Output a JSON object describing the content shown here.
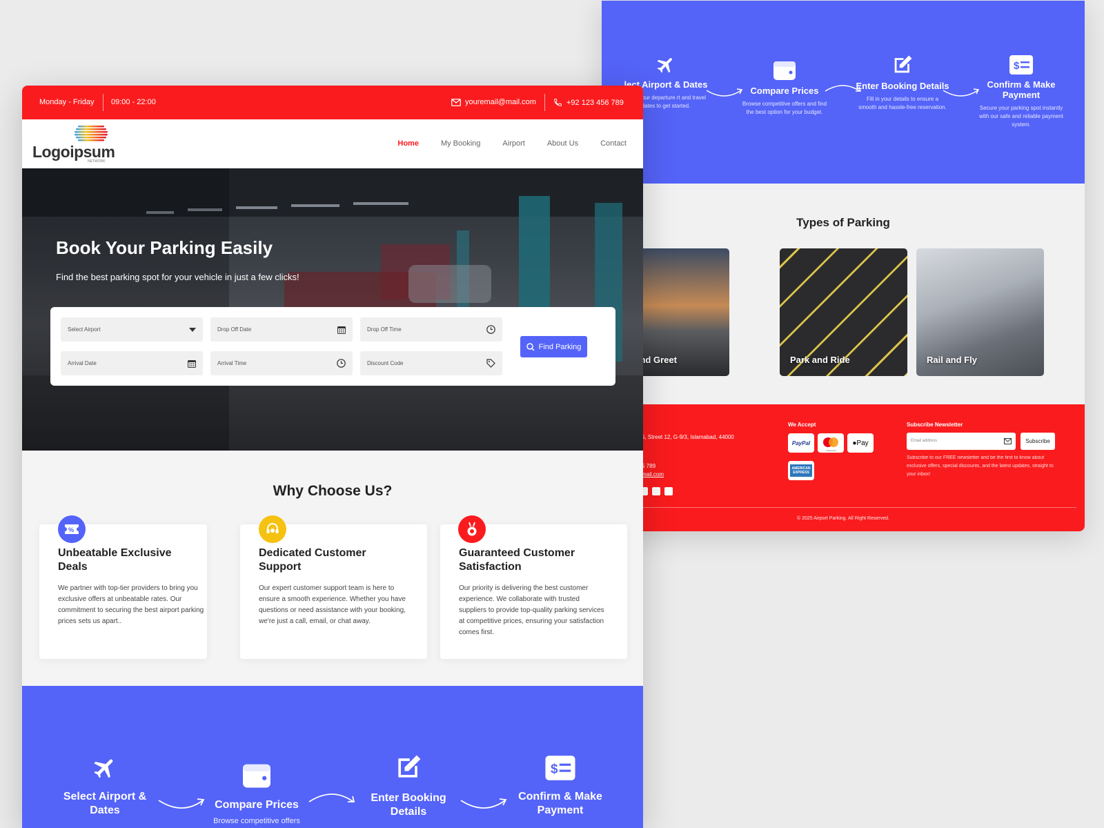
{
  "topbar": {
    "days": "Monday - Friday",
    "hours": "09:00 - 22:00",
    "email": "youremail@mail.com",
    "phone": "+92 123 456 789"
  },
  "logo": {
    "text": "Logoipsum",
    "sub": "NETWORK"
  },
  "nav": [
    {
      "label": "Home",
      "active": true
    },
    {
      "label": "My Booking"
    },
    {
      "label": "Airport"
    },
    {
      "label": "About Us"
    },
    {
      "label": "Contact"
    }
  ],
  "hero": {
    "title": "Book Your Parking Easily",
    "subtitle": "Find the best parking spot for your vehicle in just a few clicks!"
  },
  "search": {
    "select_airport": "Select Airport",
    "drop_off_date": "Drop Off Date",
    "drop_off_time": "Drop Off Time",
    "arrival_date": "Arrival Date",
    "arrival_time": "Arrival Time",
    "discount_code": "Discount Code",
    "button": "Find Parking"
  },
  "why": {
    "title": "Why Choose Us?",
    "cards": [
      {
        "title": "Unbeatable Exclusive Deals",
        "desc": "We partner with top-tier providers to bring you exclusive offers at unbeatable rates. Our commitment to securing the best airport parking prices sets us apart..",
        "icon": "discount-ticket-icon",
        "color": "#5463f8"
      },
      {
        "title": "Dedicated Customer Support",
        "desc": "Our expert customer support team is here to ensure a smooth experience. Whether you have questions or need assistance with your booking, we're just a call, email, or chat away.",
        "icon": "headset-icon",
        "color": "#f5c211"
      },
      {
        "title": "Guaranteed Customer Satisfaction",
        "desc": "Our priority is delivering the best customer experience. We collaborate with trusted suppliers to provide top-quality parking services at competitive prices, ensuring your satisfaction comes first.",
        "icon": "medal-icon",
        "color": "#fa1b1e"
      }
    ]
  },
  "steps": {
    "front": [
      {
        "title": "Select Airport & Dates",
        "icon": "airplane-icon"
      },
      {
        "title": "Compare Prices",
        "desc": "Browse competitive offers",
        "icon": "wallet-icon"
      },
      {
        "title": "Enter Booking Details",
        "icon": "edit-icon"
      },
      {
        "title": "Confirm & Make Payment",
        "icon": "payment-icon"
      }
    ],
    "back": [
      {
        "title": "lect Airport & Dates",
        "desc": "oose your departure rt and travel dates to get started.",
        "icon": "airplane-icon"
      },
      {
        "title": "Compare Prices",
        "desc": "Browse competitive offers and find the best option for your budget.",
        "icon": "wallet-icon"
      },
      {
        "title": "Enter Booking Details",
        "desc": "Fill in your details to ensure a smooth and hassle-free reservation.",
        "icon": "edit-icon"
      },
      {
        "title": "Confirm & Make Payment",
        "desc": "Secure your parking spot instantly with our safe and reliable payment system.",
        "icon": "payment-icon"
      }
    ]
  },
  "types": {
    "title": "Types of Parking",
    "items": [
      "Meet and Greet",
      "Park and Ride",
      "Rail and Fly"
    ]
  },
  "footer": {
    "address": "5, Street 12, G-9/3, Islamabad, 44000",
    "phone": "5 789",
    "email": "mail.com",
    "we_accept": "We Accept",
    "payments": [
      "PayPal",
      "mastercard",
      "Pay",
      "AMERICAN EXPRESS"
    ],
    "subscribe_title": "Subscribe Newsletter",
    "email_placeholder": "Email address",
    "subscribe_button": "Subscribe",
    "subscribe_desc": "Subscribe to our FREE newsletter and be the first to know about exclusive offers, special discounts, and the latest updates, straight to your inbox!",
    "copyright": "© 2025 Airport Parking. All Right Reserved."
  },
  "colors": {
    "red": "#fa1b1e",
    "blue": "#5463f8",
    "yellow": "#f5c211"
  }
}
